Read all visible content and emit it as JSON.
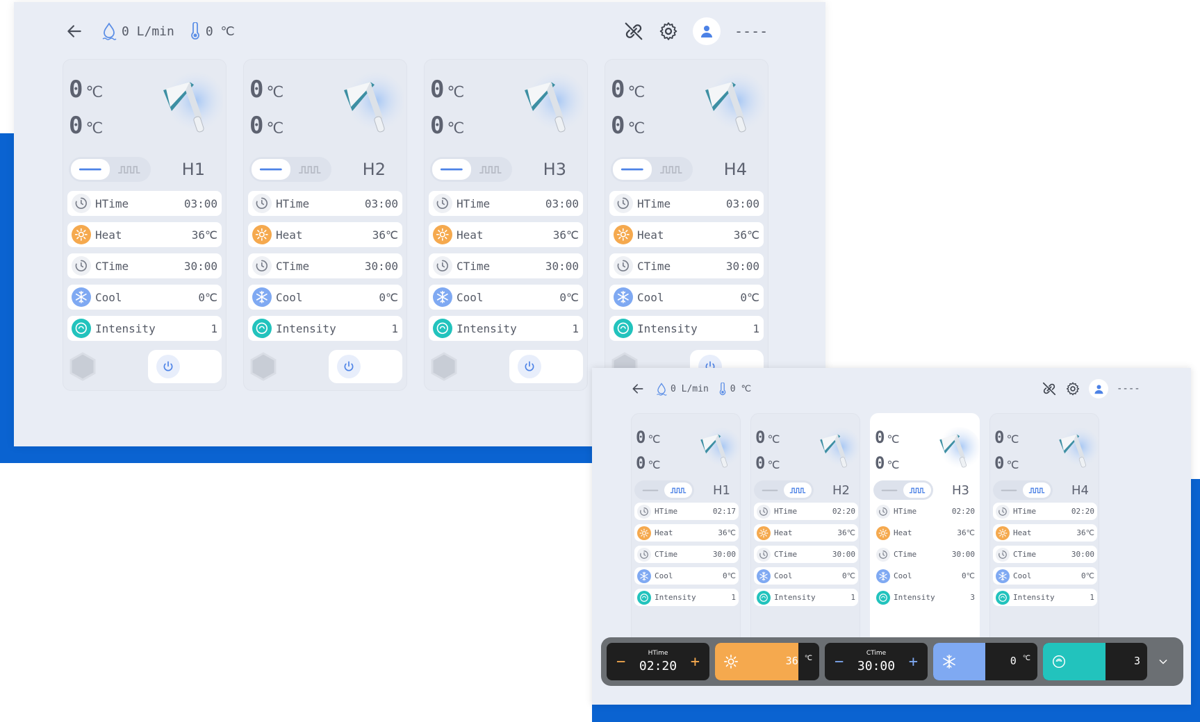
{
  "colors": {
    "accent_blue": "#0a63d1",
    "screen_bg": "#e9edf5",
    "heat": "#f5a94e",
    "cool": "#7fa9f2",
    "intensity": "#22c3bd",
    "bar_bg": "#6b6f73"
  },
  "screen1": {
    "header": {
      "flow": "0 L/min",
      "temp": "0 ℃",
      "user": "----"
    },
    "cards": [
      {
        "label": "H1",
        "temp_top": "0",
        "temp_bottom": "0",
        "unit": "℃",
        "mode": "continuous",
        "params": [
          {
            "icon": "clock-icon",
            "label": "HTime",
            "value": "03:00"
          },
          {
            "icon": "sun-icon",
            "label": "Heat",
            "value": "36℃"
          },
          {
            "icon": "clock-icon",
            "label": "CTime",
            "value": "30:00"
          },
          {
            "icon": "snowflake-icon",
            "label": "Cool",
            "value": "0℃"
          },
          {
            "icon": "intensity-icon",
            "label": "Intensity",
            "value": "1"
          }
        ]
      },
      {
        "label": "H2",
        "temp_top": "0",
        "temp_bottom": "0",
        "unit": "℃",
        "mode": "continuous",
        "params": [
          {
            "icon": "clock-icon",
            "label": "HTime",
            "value": "03:00"
          },
          {
            "icon": "sun-icon",
            "label": "Heat",
            "value": "36℃"
          },
          {
            "icon": "clock-icon",
            "label": "CTime",
            "value": "30:00"
          },
          {
            "icon": "snowflake-icon",
            "label": "Cool",
            "value": "0℃"
          },
          {
            "icon": "intensity-icon",
            "label": "Intensity",
            "value": "1"
          }
        ]
      },
      {
        "label": "H3",
        "temp_top": "0",
        "temp_bottom": "0",
        "unit": "℃",
        "mode": "continuous",
        "params": [
          {
            "icon": "clock-icon",
            "label": "HTime",
            "value": "03:00"
          },
          {
            "icon": "sun-icon",
            "label": "Heat",
            "value": "36℃"
          },
          {
            "icon": "clock-icon",
            "label": "CTime",
            "value": "30:00"
          },
          {
            "icon": "snowflake-icon",
            "label": "Cool",
            "value": "0℃"
          },
          {
            "icon": "intensity-icon",
            "label": "Intensity",
            "value": "1"
          }
        ]
      },
      {
        "label": "H4",
        "temp_top": "0",
        "temp_bottom": "0",
        "unit": "℃",
        "mode": "continuous",
        "params": [
          {
            "icon": "clock-icon",
            "label": "HTime",
            "value": "03:00"
          },
          {
            "icon": "sun-icon",
            "label": "Heat",
            "value": "36℃"
          },
          {
            "icon": "clock-icon",
            "label": "CTime",
            "value": "30:00"
          },
          {
            "icon": "snowflake-icon",
            "label": "Cool",
            "value": "0℃"
          },
          {
            "icon": "intensity-icon",
            "label": "Intensity",
            "value": "1"
          }
        ]
      }
    ]
  },
  "screen2": {
    "header": {
      "flow": "0 L/min",
      "temp": "0 ℃",
      "user": "----"
    },
    "cards": [
      {
        "label": "H1",
        "temp_top": "0",
        "temp_bottom": "0",
        "unit": "℃",
        "mode": "pulse",
        "params": [
          {
            "icon": "clock-icon",
            "label": "HTime",
            "value": "02:17"
          },
          {
            "icon": "sun-icon",
            "label": "Heat",
            "value": "36℃"
          },
          {
            "icon": "clock-icon",
            "label": "CTime",
            "value": "30:00"
          },
          {
            "icon": "snowflake-icon",
            "label": "Cool",
            "value": "0℃"
          },
          {
            "icon": "intensity-icon",
            "label": "Intensity",
            "value": "1"
          }
        ]
      },
      {
        "label": "H2",
        "temp_top": "0",
        "temp_bottom": "0",
        "unit": "℃",
        "mode": "pulse",
        "params": [
          {
            "icon": "clock-icon",
            "label": "HTime",
            "value": "02:20"
          },
          {
            "icon": "sun-icon",
            "label": "Heat",
            "value": "36℃"
          },
          {
            "icon": "clock-icon",
            "label": "CTime",
            "value": "30:00"
          },
          {
            "icon": "snowflake-icon",
            "label": "Cool",
            "value": "0℃"
          },
          {
            "icon": "intensity-icon",
            "label": "Intensity",
            "value": "1"
          }
        ]
      },
      {
        "label": "H3",
        "temp_top": "0",
        "temp_bottom": "0",
        "unit": "℃",
        "mode": "pulse",
        "active": true,
        "params": [
          {
            "icon": "clock-icon",
            "label": "HTime",
            "value": "02:20"
          },
          {
            "icon": "sun-icon",
            "label": "Heat",
            "value": "36℃"
          },
          {
            "icon": "clock-icon",
            "label": "CTime",
            "value": "30:00"
          },
          {
            "icon": "snowflake-icon",
            "label": "Cool",
            "value": "0℃"
          },
          {
            "icon": "intensity-icon",
            "label": "Intensity",
            "value": "3"
          }
        ]
      },
      {
        "label": "H4",
        "temp_top": "0",
        "temp_bottom": "0",
        "unit": "℃",
        "mode": "pulse",
        "params": [
          {
            "icon": "clock-icon",
            "label": "HTime",
            "value": "02:20"
          },
          {
            "icon": "sun-icon",
            "label": "Heat",
            "value": "36℃"
          },
          {
            "icon": "clock-icon",
            "label": "CTime",
            "value": "30:00"
          },
          {
            "icon": "snowflake-icon",
            "label": "Cool",
            "value": "0℃"
          },
          {
            "icon": "intensity-icon",
            "label": "Intensity",
            "value": "1"
          }
        ]
      }
    ],
    "control_bar": {
      "htime": {
        "title": "HTime",
        "value": "02:20"
      },
      "heat": {
        "value": "36",
        "unit": "℃",
        "level": 0.8
      },
      "ctime": {
        "title": "CTime",
        "value": "30:00"
      },
      "cool": {
        "value": "0",
        "unit": "℃",
        "level": 0.5
      },
      "intensity": {
        "value": "3",
        "level": 0.6
      }
    }
  }
}
